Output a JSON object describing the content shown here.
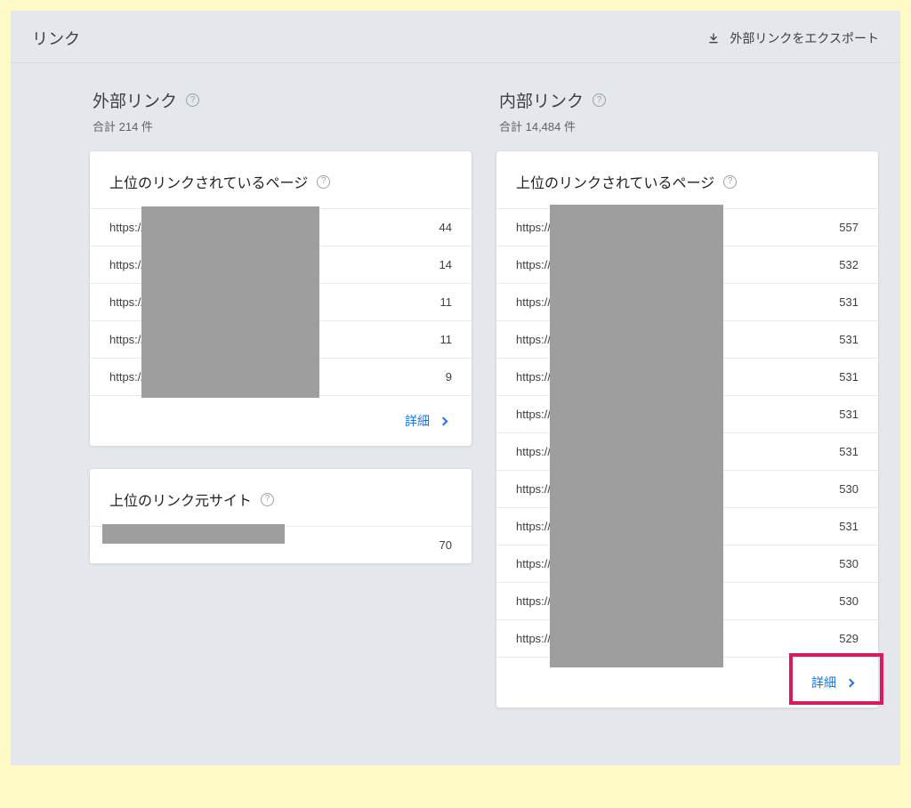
{
  "header": {
    "title": "リンク",
    "export_label": "外部リンクをエクスポート"
  },
  "external": {
    "title": "外部リンク",
    "subtitle": "合計 214 件",
    "top_linked_pages": {
      "title": "上位のリンクされているページ",
      "rows": [
        {
          "url": "https://",
          "count": "44"
        },
        {
          "url": "https://",
          "count": "14"
        },
        {
          "url": "https://",
          "count": "11"
        },
        {
          "url": "https://",
          "count": "11"
        },
        {
          "url": "https://",
          "count": "9"
        }
      ],
      "details_label": "詳細"
    },
    "top_linking_sites": {
      "title": "上位のリンク元サイト",
      "rows": [
        {
          "url": "",
          "count": "70"
        }
      ]
    }
  },
  "internal": {
    "title": "内部リンク",
    "subtitle": "合計 14,484 件",
    "top_linked_pages": {
      "title": "上位のリンクされているページ",
      "rows": [
        {
          "url": "https://",
          "count": "557"
        },
        {
          "url": "https://",
          "count": "532"
        },
        {
          "url": "https://",
          "count": "531"
        },
        {
          "url": "https://",
          "count": "531"
        },
        {
          "url": "https://",
          "count": "531"
        },
        {
          "url": "https://",
          "count": "531"
        },
        {
          "url": "https://",
          "count": "531"
        },
        {
          "url": "https://",
          "count": "530"
        },
        {
          "url": "https://",
          "count": "531"
        },
        {
          "url": "https://",
          "count": "530"
        },
        {
          "url": "https://",
          "count": "530"
        },
        {
          "url": "https://",
          "count": "529"
        }
      ],
      "details_label": "詳細"
    }
  }
}
